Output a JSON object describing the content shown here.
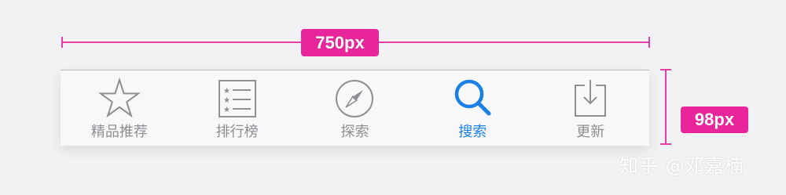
{
  "annotations": {
    "width_label": "750px",
    "height_label": "98px",
    "color": "#e8259a"
  },
  "tab_bar": {
    "active_color": "#1a7fe6",
    "inactive_color": "#8e8e93",
    "tabs": [
      {
        "label": "精品推荐",
        "icon": "star-icon",
        "active": false
      },
      {
        "label": "排行榜",
        "icon": "ranking-list-icon",
        "active": false
      },
      {
        "label": "探索",
        "icon": "compass-icon",
        "active": false
      },
      {
        "label": "搜索",
        "icon": "search-icon",
        "active": true
      },
      {
        "label": "更新",
        "icon": "download-update-icon",
        "active": false
      }
    ]
  },
  "watermark": "知乎 @邓嘉楠"
}
